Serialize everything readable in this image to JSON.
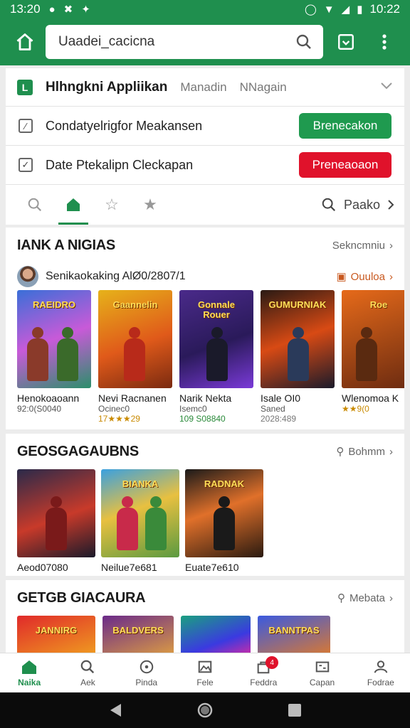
{
  "status_bar": {
    "time_left": "13:20",
    "time_right": "10:22"
  },
  "search": {
    "value": "Uaadei_cacicna",
    "placeholder": ""
  },
  "header": {
    "title": "Hlhngkni  Appliikan",
    "tabs": [
      "Manadin",
      "NNagain"
    ]
  },
  "actions": [
    {
      "label": "Condatyelrigfor Meakansen",
      "button": "Brenecakon",
      "color": "#1f9a4f"
    },
    {
      "label": "Date Ptekalipn Cleckapan",
      "button": "Preneaoaon",
      "color": "#e0122b"
    }
  ],
  "icon_tabs": {
    "icons": [
      "search-icon",
      "home-icon",
      "star-outline-icon",
      "star-icon"
    ],
    "active": 1,
    "right_label": "Paako"
  },
  "section1": {
    "title": "IANK A NIGIAS",
    "link": "Sekncmniu",
    "subtitle": "Senikaokaking AlØ0/2807/1",
    "sub_link": "Ouuloa",
    "cards": [
      {
        "art": "RAEIDRO",
        "name": "Henokoaoann",
        "meta": "92:0(S0040",
        "rating": "",
        "bg": "linear-gradient(160deg,#3a6fd8,#c85ad8 50%,#2b8f6a)"
      },
      {
        "art": "Gaannelin",
        "name": "Nevi Racnanen",
        "meta": "Ocinec0",
        "rating": "17★★★29",
        "bg": "linear-gradient(160deg,#e6b21a,#e05a1a 55%,#7a2a10)"
      },
      {
        "art": "Gonnale Rouer",
        "name": "Narik Nekta",
        "meta": "Isemc0",
        "rating": "109 S08840",
        "bg": "linear-gradient(160deg,#4a2a8a,#2a1a5a 55%,#7a3ad8)"
      },
      {
        "art": "GUMURNIAK",
        "name": "Isale OI0",
        "meta": "Saned",
        "rating": "2028:489",
        "bg": "linear-gradient(160deg,#2a1a14,#d84a14 50%,#1a1a2a)"
      },
      {
        "art": "Roe",
        "name": "Wlenomoa K",
        "meta": "",
        "rating": "★★9(0",
        "bg": "linear-gradient(160deg,#e66a1a,#6a2a10)"
      }
    ]
  },
  "section2": {
    "title": "GEOSGAGAUBNS",
    "link": "Bohmm",
    "cards": [
      {
        "art": "",
        "name": "Aeod07080",
        "bg": "linear-gradient(160deg,#2a2a4a,#c83a2a 55%,#1a1a2a)"
      },
      {
        "art": "BIANKA",
        "name": "Neilue7e681",
        "bg": "linear-gradient(160deg,#3aa0e0,#e8c040 45%,#5a9a40)"
      },
      {
        "art": "RADNAK",
        "name": "Euate7e610",
        "bg": "linear-gradient(160deg,#1a1a1a,#e0702a 45%,#2a1a10)"
      }
    ]
  },
  "section3": {
    "title": "GETGB GIACAURA",
    "link": "Mebata",
    "cards": [
      {
        "art": "JANNIRG",
        "bg": "linear-gradient(160deg,#e02a2a,#f0a020)"
      },
      {
        "art": "BALDVERS",
        "bg": "linear-gradient(160deg,#6a2a8a,#e0a040)"
      },
      {
        "art": "",
        "bg": "linear-gradient(160deg,#1aa080,#3a3ae0 60%,#e02aa0)"
      },
      {
        "art": "BANNTPAS",
        "bg": "linear-gradient(160deg,#3a5ae0,#e07a2a)"
      }
    ]
  },
  "bottom_nav": [
    {
      "label": "Naika",
      "icon": "home-icon"
    },
    {
      "label": "Aek",
      "icon": "search-icon"
    },
    {
      "label": "Pinda",
      "icon": "compass-icon"
    },
    {
      "label": "Fele",
      "icon": "image-icon"
    },
    {
      "label": "Feddra",
      "icon": "bag-icon",
      "badge": "4"
    },
    {
      "label": "Capan",
      "icon": "card-icon"
    },
    {
      "label": "Fodrae",
      "icon": "person-icon"
    }
  ],
  "colors": {
    "brand": "#1f8f4e",
    "danger": "#e0122b"
  }
}
